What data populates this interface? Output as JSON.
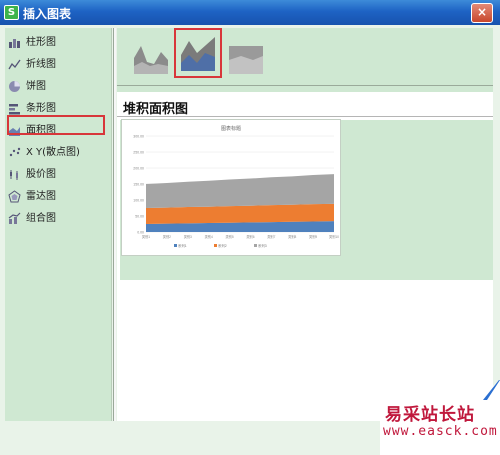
{
  "window": {
    "title": "插入图表",
    "app_icon": "S",
    "close_glyph": "×"
  },
  "sidebar": {
    "items": [
      {
        "label": "柱形图",
        "icon": "column-chart-icon"
      },
      {
        "label": "折线图",
        "icon": "line-chart-icon"
      },
      {
        "label": "饼图",
        "icon": "pie-chart-icon"
      },
      {
        "label": "条形图",
        "icon": "bar-chart-icon"
      },
      {
        "label": "面积图",
        "icon": "area-chart-icon",
        "selected": true
      },
      {
        "label": "X Y(散点图)",
        "icon": "scatter-chart-icon"
      },
      {
        "label": "股价图",
        "icon": "stock-chart-icon"
      },
      {
        "label": "雷达图",
        "icon": "radar-chart-icon"
      },
      {
        "label": "组合图",
        "icon": "combo-chart-icon"
      }
    ]
  },
  "subtypes": {
    "items": [
      {
        "name": "area"
      },
      {
        "name": "stacked-area",
        "selected": true
      },
      {
        "name": "percent-stacked-area"
      }
    ]
  },
  "preview": {
    "heading": "堆积面积图",
    "chart_title": "图表标题"
  },
  "chart_data": {
    "type": "area",
    "title": "图表标题",
    "stacked": true,
    "categories": [
      "类别1",
      "类别2",
      "类别3",
      "类别4",
      "类别5",
      "类别6",
      "类别7",
      "类别8",
      "类别9",
      "类别10"
    ],
    "y_ticks": [
      "0.00",
      "50.00",
      "100.00",
      "150.00",
      "200.00",
      "250.00",
      "300.00"
    ],
    "ylim": [
      0,
      300
    ],
    "series": [
      {
        "name": "系列1",
        "values": [
          25,
          26,
          27,
          28,
          29,
          30,
          31,
          32,
          33,
          34
        ],
        "color": "#4f81bd"
      },
      {
        "name": "系列2",
        "values": [
          50,
          50,
          51,
          51,
          52,
          52,
          53,
          53,
          54,
          54
        ],
        "color": "#ed7d31"
      },
      {
        "name": "系列3",
        "values": [
          75,
          77,
          79,
          81,
          83,
          85,
          87,
          89,
          91,
          93
        ],
        "color": "#a5a5a5"
      }
    ],
    "legend_placement": "bottom",
    "grid": true
  },
  "watermark": {
    "title": "易采站长站",
    "url": "www.easck.com"
  },
  "colors": {
    "accent_red": "#d8363a",
    "panel_green": "#cfe8d2",
    "title_blue": "#1e63c4"
  }
}
